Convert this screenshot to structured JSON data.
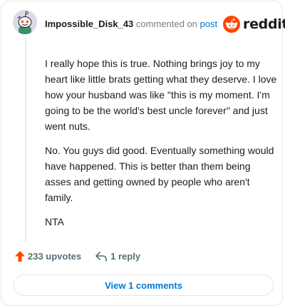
{
  "comment": {
    "username": "Impossible_Disk_43",
    "commented_on_text": "commented on",
    "post_link_text": "post",
    "body_paragraphs": [
      "I really hope this is true. Nothing brings joy to my heart like little brats getting what they deserve. I love how your husband was like \"this is my moment. I'm going to be the world's best uncle forever\" and just went nuts.",
      "No. You guys did good. Eventually something would have happened. This is better than them being asses and getting owned by people who aren't family.",
      "NTA"
    ],
    "upvotes_label": "233 upvotes",
    "replies_label": "1 reply"
  },
  "brand": {
    "wordmark": "reddit",
    "logo_color": "#ff4500"
  },
  "footer": {
    "view_comments_label": "View 1 comments"
  },
  "colors": {
    "link": "#0079d3",
    "upvote": "#ff4500",
    "muted": "#576f76"
  }
}
